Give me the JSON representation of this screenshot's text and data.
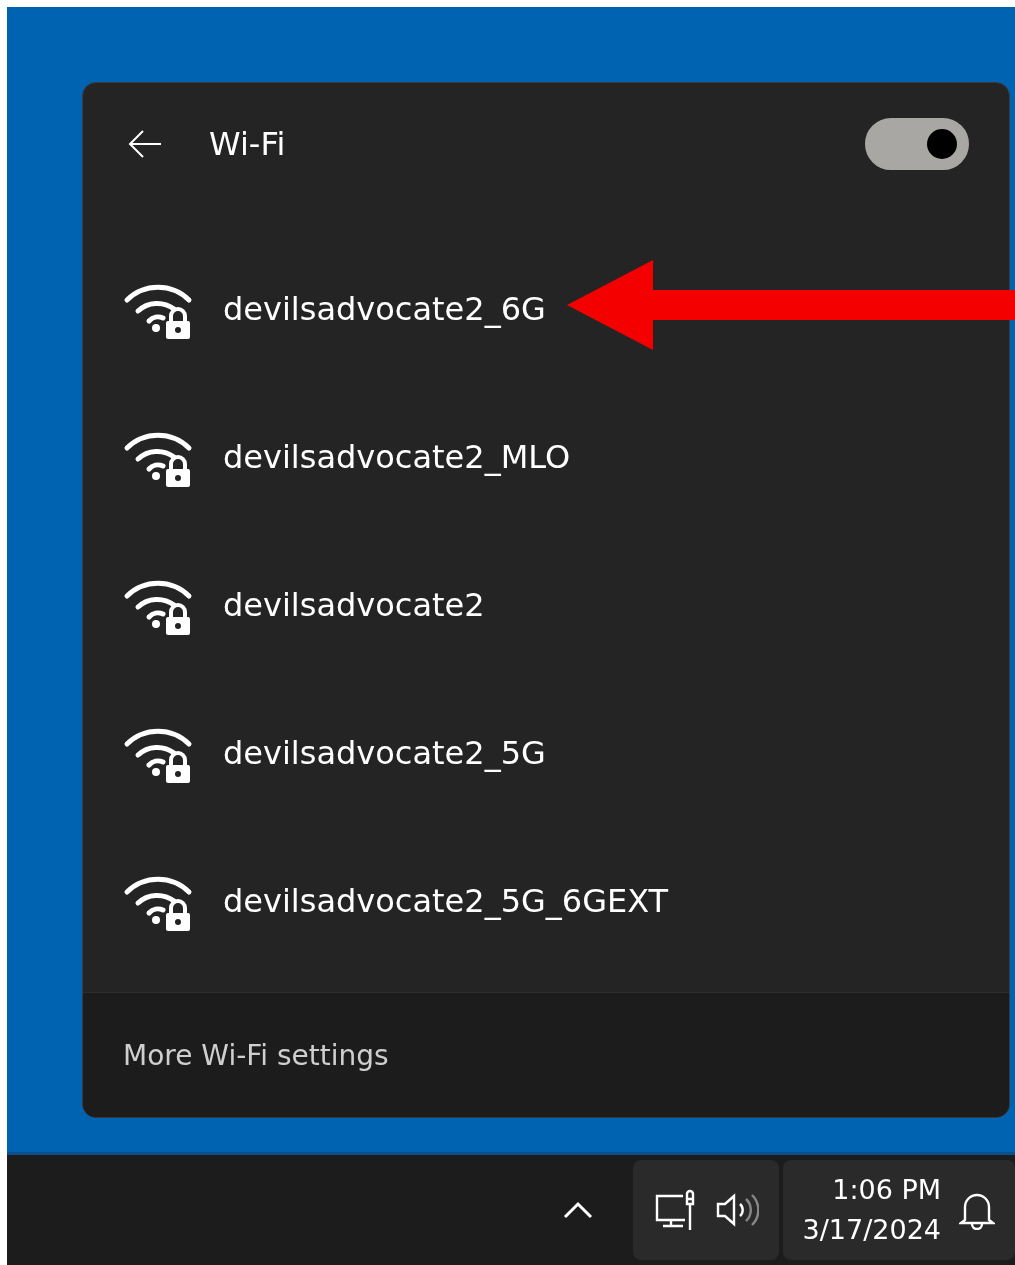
{
  "panel": {
    "title": "Wi-Fi",
    "wifi_toggle": {
      "on": true
    }
  },
  "networks": [
    {
      "name": "devilsadvocate2_6G",
      "secured": true
    },
    {
      "name": "devilsadvocate2_MLO",
      "secured": true
    },
    {
      "name": "devilsadvocate2",
      "secured": true
    },
    {
      "name": "devilsadvocate2_5G",
      "secured": true
    },
    {
      "name": "devilsadvocate2_5G_6GEXT",
      "secured": true
    }
  ],
  "footer": {
    "link": "More Wi-Fi settings"
  },
  "taskbar": {
    "time": "1:06 PM",
    "date": "3/17/2024"
  }
}
